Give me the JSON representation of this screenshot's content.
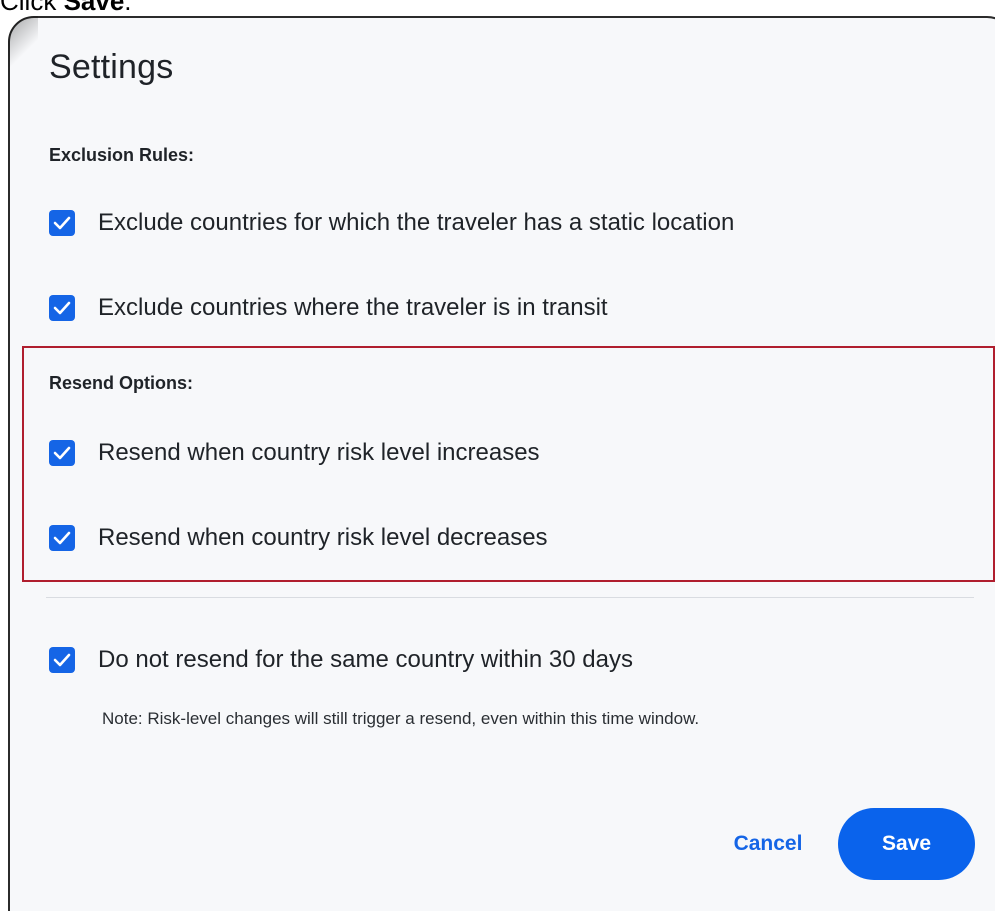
{
  "instruction": {
    "prefix": "Click ",
    "target": "Save",
    "suffix": "."
  },
  "dialog": {
    "title": "Settings",
    "exclusion_rules": {
      "label": "Exclusion Rules:",
      "items": [
        {
          "label": "Exclude countries for which the traveler has a static location",
          "checked": true
        },
        {
          "label": "Exclude countries where the traveler is in transit",
          "checked": true
        }
      ]
    },
    "resend_options": {
      "label": "Resend Options:",
      "items": [
        {
          "label": "Resend when country risk level increases",
          "checked": true
        },
        {
          "label": "Resend when country risk level decreases",
          "checked": true
        }
      ]
    },
    "no_resend": {
      "label": "Do not resend for the same country within 30 days",
      "checked": true,
      "note": "Note: Risk-level changes will still trigger a resend, even within this time window."
    },
    "buttons": {
      "cancel": "Cancel",
      "save": "Save"
    }
  },
  "colors": {
    "accent": "#0a63ec",
    "checkbox": "#1565e6",
    "highlight": "#b01e2e",
    "dialog_bg": "#f7f8fa"
  },
  "icons": {
    "checkbox_mark": "checkmark-icon"
  }
}
